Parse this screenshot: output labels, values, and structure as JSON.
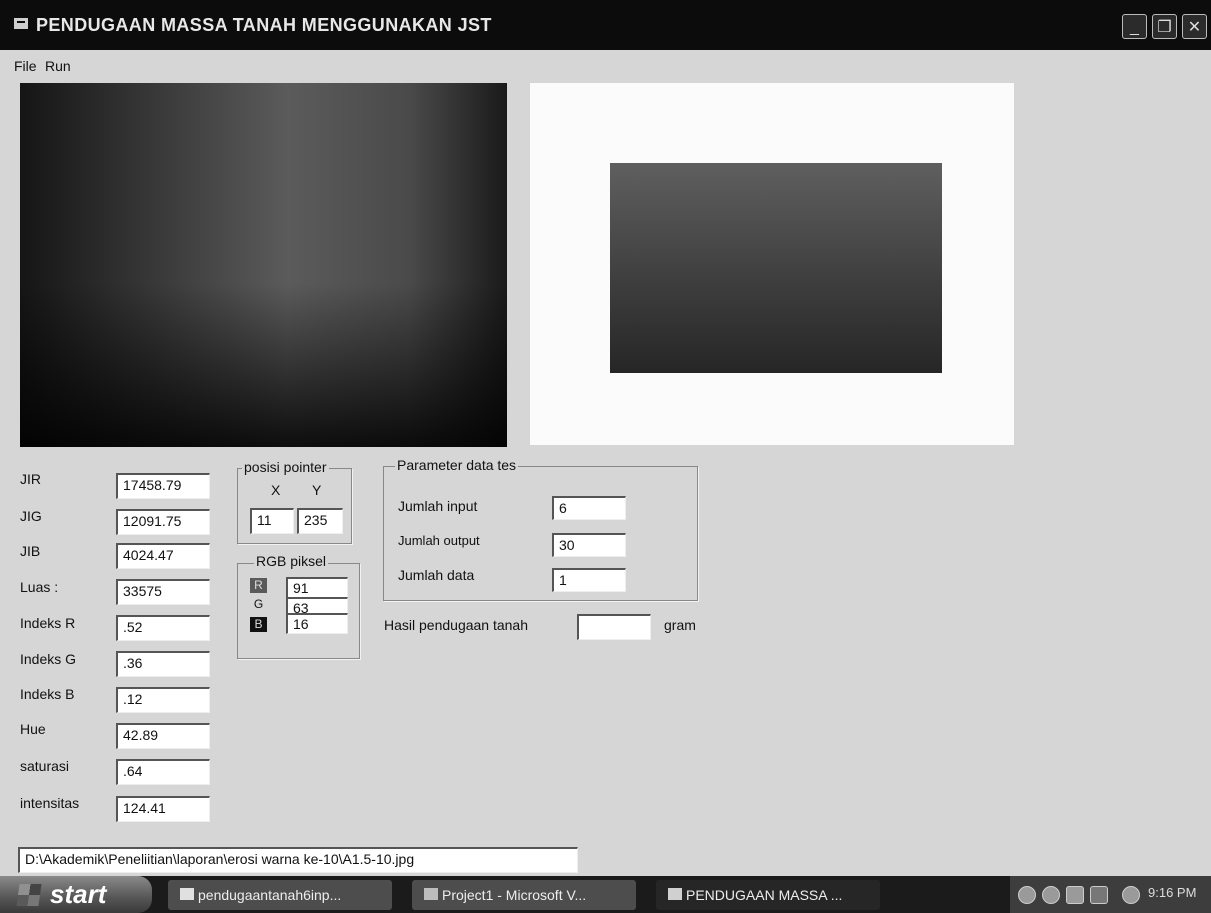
{
  "window": {
    "title": "PENDUGAAN MASSA TANAH MENGGUNAKAN JST",
    "minimize_icon": "minimize-icon",
    "maximize_icon": "maximize-icon",
    "close_icon": "close-icon",
    "minimize_glyph": "_",
    "maximize_glyph": "❐",
    "close_glyph": "✕"
  },
  "menu": {
    "file": "File",
    "run": "Run"
  },
  "fields": [
    {
      "label": "JIR",
      "value": "17458.79"
    },
    {
      "label": "JIG",
      "value": "12091.75"
    },
    {
      "label": "JIB",
      "value": "4024.47"
    },
    {
      "label": "Luas :",
      "value": "33575"
    },
    {
      "label": "Indeks R",
      "value": ".52"
    },
    {
      "label": "Indeks G",
      "value": ".36"
    },
    {
      "label": "Indeks B",
      "value": ".12"
    },
    {
      "label": "Hue",
      "value": "42.89"
    },
    {
      "label": "saturasi",
      "value": ".64"
    },
    {
      "label": "intensitas",
      "value": "124.41"
    }
  ],
  "pointer": {
    "title": "posisi pointer",
    "x_label": "X",
    "y_label": "Y",
    "x_value": "11",
    "y_value": "235"
  },
  "rgb": {
    "title": "RGB piksel",
    "r_label": "R",
    "g_label": "G",
    "b_label": "B",
    "r_value": "91",
    "g_value": "63",
    "b_value": "16"
  },
  "params": {
    "title": "Parameter data tes",
    "input_label": "Jumlah input",
    "input_value": "6",
    "output_label": "Jumlah output",
    "output_value": "30",
    "data_label": "Jumlah data",
    "data_value": "1"
  },
  "result": {
    "label": "Hasil pendugaan tanah",
    "value": "",
    "unit": "gram"
  },
  "path": "D:\\Akademik\\Peneliitian\\laporan\\erosi warna ke-10\\A1.5-10.jpg",
  "taskbar": {
    "start": "start",
    "tasks": [
      "pendugaantanah6inp...",
      "Project1 - Microsoft V...",
      "PENDUGAAN MASSA ..."
    ],
    "clock": "9:16 PM"
  },
  "colors": {
    "titlebar": "#0c0c0c",
    "window_bg": "#d6d6d6",
    "taskbar": "#1b1b1b"
  }
}
